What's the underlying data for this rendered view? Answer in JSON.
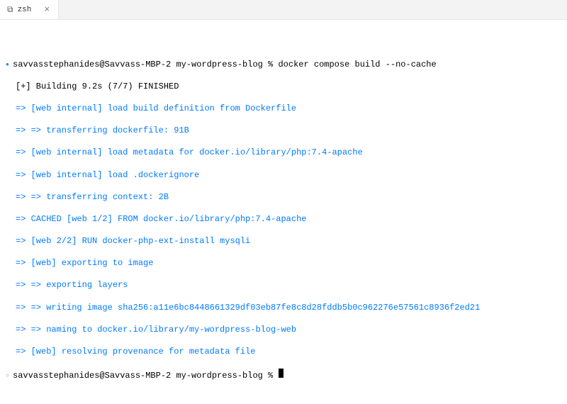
{
  "tab": {
    "icon": "⧉",
    "title": "zsh",
    "close": "×"
  },
  "terminal": {
    "prompt1_prefix": "savvasstephanides@Savvass-MBP-2 my-wordpress-blog % ",
    "command": "docker compose build --no-cache",
    "build_header": "[+] Building 9.2s (7/7) FINISHED",
    "steps": [
      "=> [web internal] load build definition from Dockerfile",
      "=> => transferring dockerfile: 91B",
      "=> [web internal] load metadata for docker.io/library/php:7.4-apache",
      "=> [web internal] load .dockerignore",
      "=> => transferring context: 2B",
      "=> CACHED [web 1/2] FROM docker.io/library/php:7.4-apache",
      "=> [web 2/2] RUN docker-php-ext-install mysqli",
      "=> [web] exporting to image",
      "=> => exporting layers",
      "=> => writing image sha256:a11e6bc8448661329df03eb87fe8c8d28fddb5b0c962276e57561c8936f2ed21",
      "=> => naming to docker.io/library/my-wordpress-blog-web",
      "=> [web] resolving provenance for metadata file"
    ],
    "prompt2_prefix": "savvasstephanides@Savvass-MBP-2 my-wordpress-blog % "
  }
}
